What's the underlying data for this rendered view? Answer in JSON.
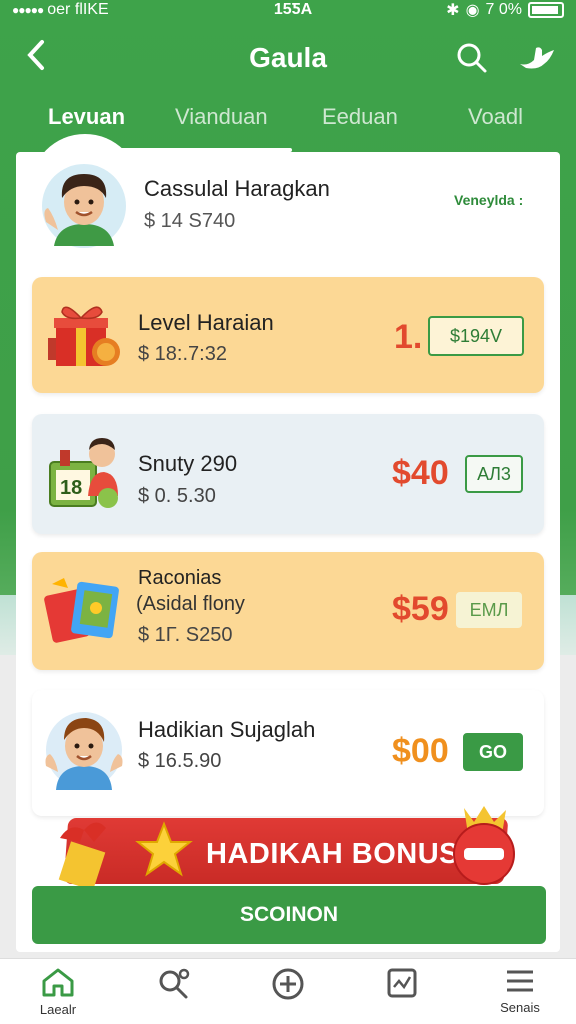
{
  "status": {
    "carrier": "oer ﬂIKE",
    "time": "15ƼA",
    "battery": "7 0%"
  },
  "header": {
    "title": "Gaula"
  },
  "tabs": [
    {
      "label": "Levuan",
      "active": true
    },
    {
      "label": "Vianduan",
      "active": false
    },
    {
      "label": "Eeduan",
      "active": false
    },
    {
      "label": "Voadl",
      "active": false
    }
  ],
  "profile": {
    "name": "Cassulal Haragkan",
    "balance": "$ 14 S740",
    "badge": "Veneylda :"
  },
  "rewards": [
    {
      "name": "Level Haraian",
      "sub": "",
      "amount": "$ 18:.7:32",
      "price": "1.",
      "button": "$194V",
      "price_color": "#e24a2e"
    },
    {
      "name": "Snuty 290",
      "sub": "",
      "amount": "$ 0. 5.30",
      "price": "$40",
      "button": "AЛ3",
      "price_color": "#e24a2e"
    },
    {
      "name": "Raconias",
      "sub": "(Asidal flony",
      "amount": "$ 1Γ. S250",
      "price": "$59",
      "button": "EMЛ",
      "price_color": "#e24a2e"
    },
    {
      "name": "Hadikian Sujaglah",
      "sub": "",
      "amount": "$ 16.5.90",
      "price": "$00",
      "button": "GO",
      "price_color": "#f0901e"
    }
  ],
  "bonus": {
    "label": "HADIKAH BONUS"
  },
  "submit": {
    "label": "SCOINON"
  },
  "nav": [
    {
      "label": "Laealr",
      "icon": "home-icon"
    },
    {
      "label": "",
      "icon": "search-people-icon"
    },
    {
      "label": "",
      "icon": "plus-circle-icon"
    },
    {
      "label": "",
      "icon": "chart-icon"
    },
    {
      "label": "Senais",
      "icon": "menu-icon"
    }
  ],
  "colors": {
    "brand_green": "#3ea34a",
    "card_yellow": "#fcd895",
    "card_blue": "#e9f0f4",
    "bonus_red": "#d6302b"
  }
}
